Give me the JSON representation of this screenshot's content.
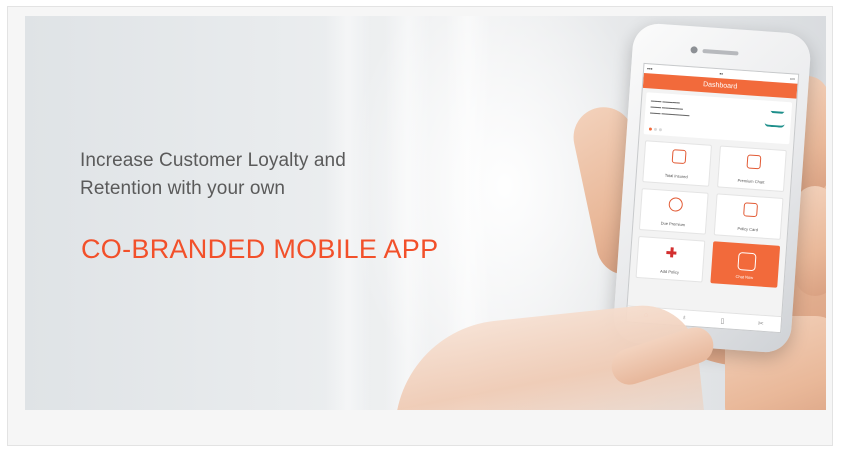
{
  "banner": {
    "headline_line1": "Increase Customer Loyalty and",
    "headline_line2": "Retention with your own",
    "cta": "CO-BRANDED MOBILE APP"
  },
  "phone_screen": {
    "app_header": "Dashboard",
    "tiles": [
      {
        "label": "Total Insured"
      },
      {
        "label": "Premium Chart"
      },
      {
        "label": "Due Premium"
      },
      {
        "label": "Policy Card"
      },
      {
        "label": "Add Policy"
      },
      {
        "label": "Chat Now"
      }
    ],
    "tabbar_icons": [
      "home-icon",
      "bell-icon",
      "document-icon",
      "share-icon"
    ]
  },
  "colors": {
    "accent": "#f2502a",
    "app_header": "#f26a3b",
    "headline_text": "#5a5a5a"
  }
}
